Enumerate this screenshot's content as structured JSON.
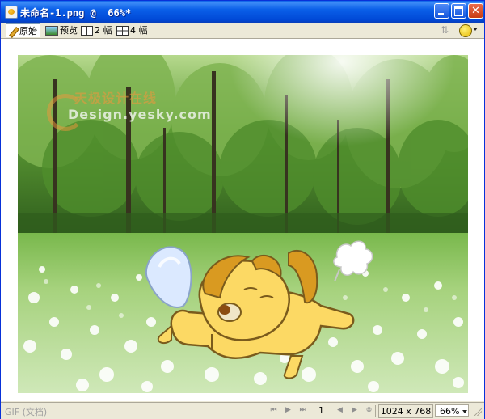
{
  "window": {
    "title": "未命名-1.png @  66%*"
  },
  "toolbar": {
    "tabs": [
      {
        "label": "原始",
        "active": true,
        "icon": "pencil-icon"
      },
      {
        "label": "预览",
        "active": false,
        "icon": "preview-icon"
      },
      {
        "label": "2 幅",
        "active": false,
        "icon": "two-up-icon"
      },
      {
        "label": "4 幅",
        "active": false,
        "icon": "four-up-icon"
      }
    ]
  },
  "canvas": {
    "watermark_line1": "天极设计在线",
    "watermark_line2": "Design.yesky.com"
  },
  "statusbar": {
    "format": "GIF (文档)",
    "frame": "1",
    "dimensions": "1024 x 768",
    "zoom": "66%"
  },
  "colors": {
    "titlebar": "#0a5fe8",
    "chrome": "#ece9d8"
  }
}
